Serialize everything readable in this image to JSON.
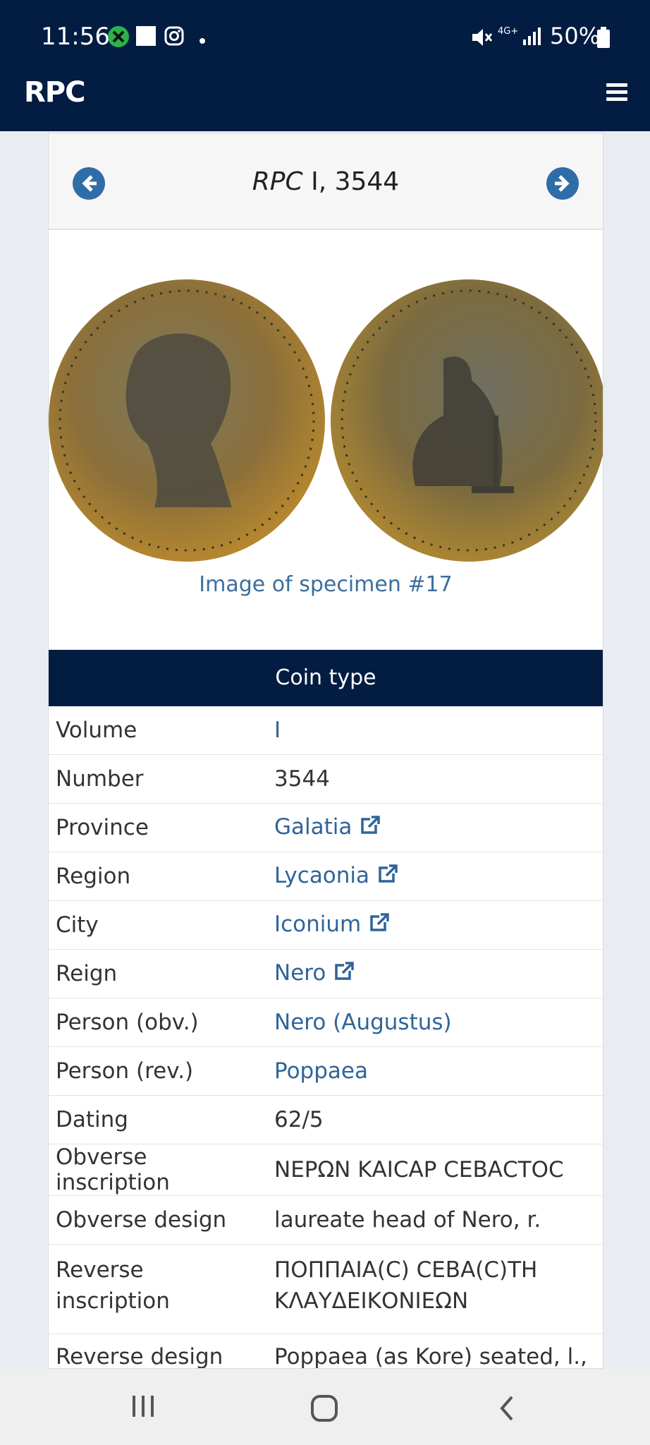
{
  "status": {
    "time": "11:56",
    "network": "4G+",
    "battery": "50%"
  },
  "app": {
    "brand": "RPC"
  },
  "card": {
    "title_italic": "RPC",
    "title_rest": " I, 3544",
    "image_caption": "Image of specimen #17",
    "section_title": "Coin type"
  },
  "rows": [
    {
      "label": "Volume",
      "value": "I",
      "link": true,
      "external": false
    },
    {
      "label": "Number",
      "value": "3544",
      "link": false,
      "external": false
    },
    {
      "label": "Province",
      "value": "Galatia",
      "link": true,
      "external": true
    },
    {
      "label": "Region",
      "value": "Lycaonia",
      "link": true,
      "external": true
    },
    {
      "label": "City",
      "value": "Iconium",
      "link": true,
      "external": true
    },
    {
      "label": "Reign",
      "value": "Nero",
      "link": true,
      "external": true
    },
    {
      "label": "Person (obv.)",
      "value": "Nero (Augustus)",
      "link": true,
      "external": false
    },
    {
      "label": "Person (rev.)",
      "value": "Poppaea",
      "link": true,
      "external": false
    },
    {
      "label": "Dating",
      "value": "62/5",
      "link": false,
      "external": false
    },
    {
      "label": "Obverse inscription",
      "value": "ΝΕΡΩΝ ΚΑΙCΑΡ CΕΒΑCΤΟC",
      "link": false,
      "external": false
    },
    {
      "label": "Obverse design",
      "value": "laureate head of Nero, r.",
      "link": false,
      "external": false
    },
    {
      "label": "Reverse inscription",
      "value": "ΠΟΠΠΑΙΑ(C) CΕΒΑ(C)ΤΗ ΚΛΑΥΔΕΙΚΟΝΙΕΩΝ",
      "link": false,
      "external": false
    },
    {
      "label": "Reverse design",
      "value": "Poppaea (as Kore) seated, l.,",
      "link": false,
      "external": false
    }
  ],
  "colors": {
    "navy": "#031c42",
    "link": "#2f6499",
    "accent": "#2f6da8"
  }
}
